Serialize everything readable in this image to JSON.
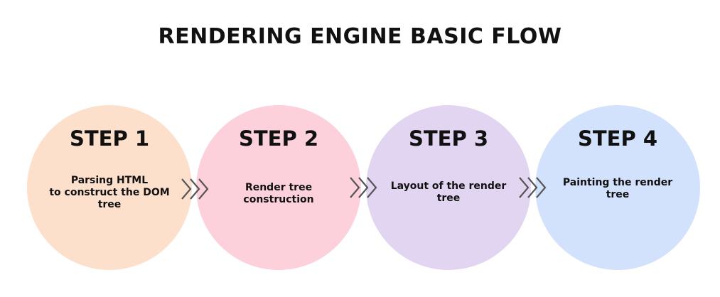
{
  "title": "RENDERING ENGINE BASIC FLOW",
  "steps": [
    {
      "label": "STEP 1",
      "desc": "Parsing HTML\nto construct the DOM\ntree",
      "color": "#fde0cc"
    },
    {
      "label": "STEP 2",
      "desc": "Render tree\nconstruction",
      "color": "#fdd1dc"
    },
    {
      "label": "STEP 3",
      "desc": "Layout of the render\ntree",
      "color": "#e2d5f2"
    },
    {
      "label": "STEP 4",
      "desc": "Painting the render\ntree",
      "color": "#d3e2fc"
    }
  ],
  "connector_icon": "triple-chevron-right-icon"
}
